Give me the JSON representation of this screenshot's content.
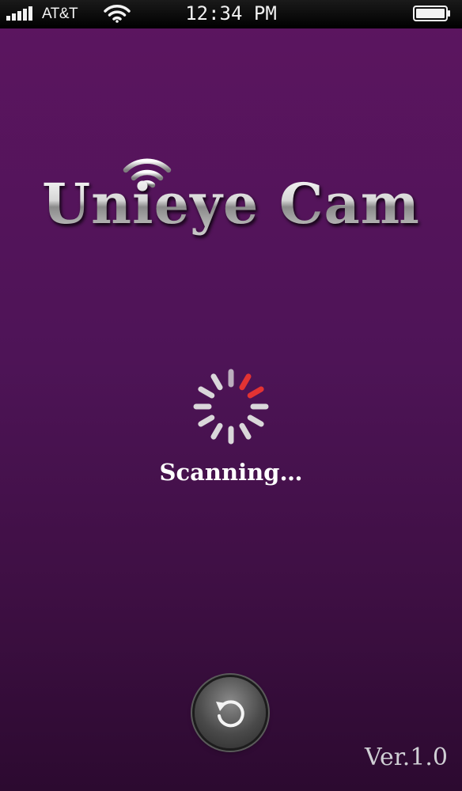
{
  "status_bar": {
    "carrier": "AT&T",
    "time": "12:34 PM",
    "signal_bars": 5,
    "wifi_icon": "wifi-icon",
    "battery_icon": "battery-full-icon"
  },
  "app": {
    "title": "Unieye Cam",
    "logo_icon": "wifi-signal-icon"
  },
  "scan": {
    "status_text": "Scanning…",
    "spinner_icon": "loading-spinner-icon",
    "accent_color": "#e23333"
  },
  "footer": {
    "refresh_icon": "refresh-icon",
    "version": "Ver.1.0"
  }
}
